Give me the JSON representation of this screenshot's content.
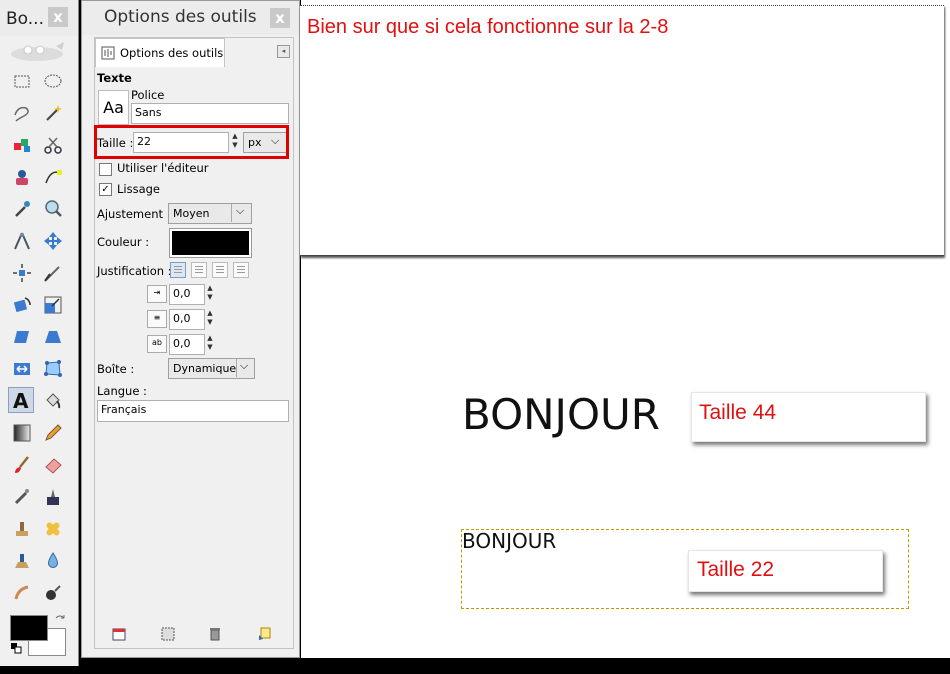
{
  "toolbox": {
    "title": "Bo...",
    "close": "x",
    "tools": [
      "rect-select",
      "ellipse-select",
      "free-select",
      "fuzzy-select",
      "color-select",
      "scissors",
      "foreground-select",
      "paths",
      "color-picker",
      "zoom",
      "measure",
      "move",
      "align",
      "crop",
      "rotate",
      "scale",
      "shear",
      "perspective",
      "flip",
      "cage",
      "text",
      "bucket-fill",
      "blend",
      "pencil",
      "paintbrush",
      "eraser",
      "airbrush",
      "ink",
      "clone",
      "heal",
      "perspective-clone",
      "blur",
      "smudge",
      "dodge-burn"
    ]
  },
  "options": {
    "title": "Options des outils",
    "close": "x",
    "tab_label": "Options des outils",
    "section": "Texte",
    "font_label": "Police",
    "font_preview": "Aa",
    "font_value": "Sans",
    "size_label": "Taille :",
    "size_value": "22",
    "size_unit": "px",
    "use_editor": "Utiliser l'éditeur",
    "antialias": "Lissage",
    "hinting_label": "Ajustement :",
    "hinting_value": "Moyen",
    "color_label": "Couleur :",
    "text_color": "#000000",
    "justify_label": "Justification :",
    "indent_value": "0,0",
    "line_spacing_value": "0,0",
    "letter_spacing_value": "0,0",
    "box_label": "Boîte :",
    "box_value": "Dynamique",
    "lang_label": "Langue :",
    "lang_value": "Français"
  },
  "canvas": {
    "note": "Bien sur que si cela fonctionne sur la 2-8",
    "text_large": "BONJOUR",
    "label_large": "Taille 44",
    "text_small": "BONJOUR",
    "label_small": "Taille 22",
    "accent": "#e01010",
    "highlight": "#e00000"
  }
}
